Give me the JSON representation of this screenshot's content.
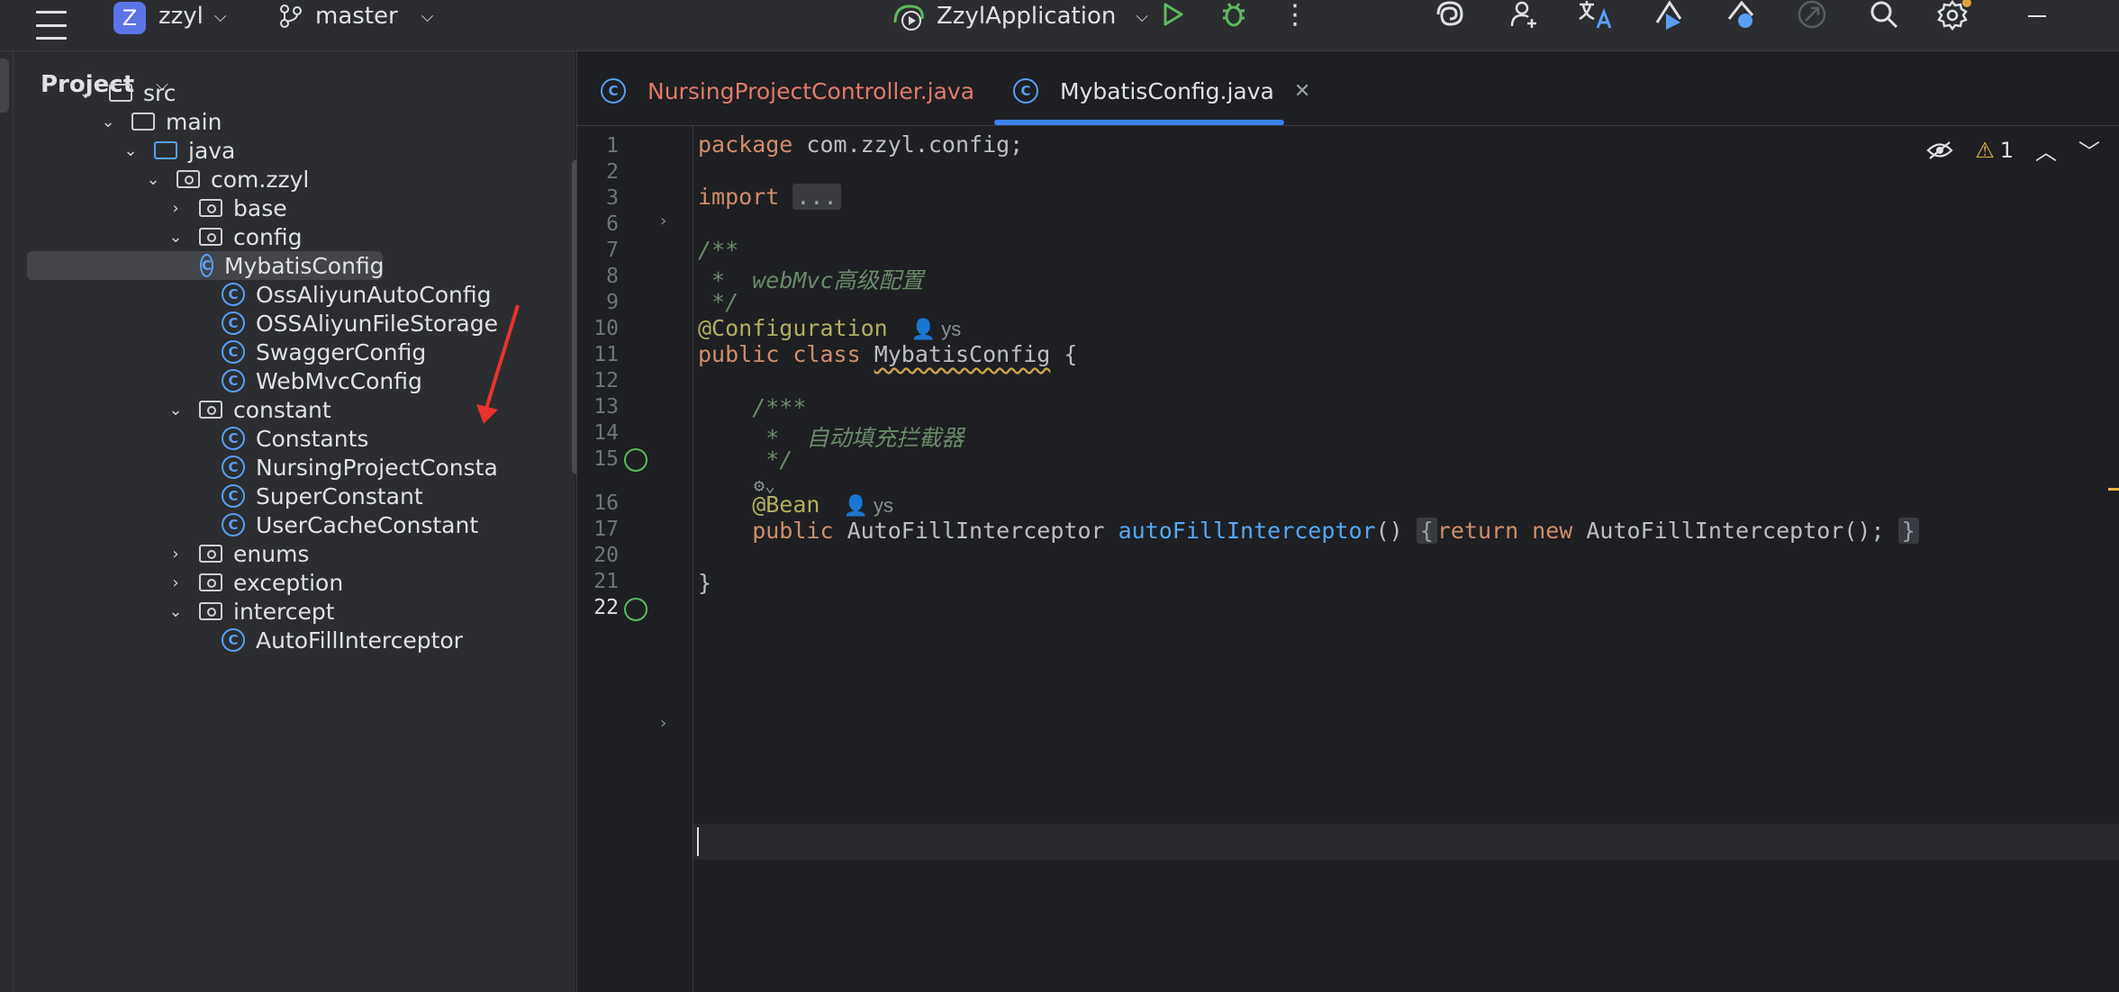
{
  "toolbar": {
    "project_initial": "Z",
    "project_name": "zzyl",
    "branch": "master",
    "run_config": "ZzylApplication",
    "icons": [
      "menu-icon",
      "branch-icon",
      "run-config-icon",
      "run-icon",
      "debug-icon",
      "more-icon",
      "ai-assistant-icon",
      "add-user-icon",
      "translate-icon",
      "deploy-icon",
      "bug-deploy-icon",
      "rocket-icon",
      "search-icon",
      "settings-icon",
      "minimize-icon"
    ]
  },
  "project_panel": {
    "title": "Project",
    "tree": [
      {
        "label": "src",
        "kind": "folder",
        "level": 0,
        "state": "open"
      },
      {
        "label": "main",
        "kind": "folder",
        "level": 1,
        "state": "open"
      },
      {
        "label": "java",
        "kind": "java",
        "level": 2,
        "state": "open"
      },
      {
        "label": "com.zzyl",
        "kind": "pkg",
        "level": 3,
        "state": "open"
      },
      {
        "label": "base",
        "kind": "pkg",
        "level": 4,
        "state": "closed"
      },
      {
        "label": "config",
        "kind": "pkg",
        "level": 4,
        "state": "open"
      },
      {
        "label": "MybatisConfig",
        "kind": "class",
        "level": 5,
        "state": "leaf",
        "selected": true
      },
      {
        "label": "OssAliyunAutoConfig",
        "kind": "class",
        "level": 5,
        "state": "leaf"
      },
      {
        "label": "OSSAliyunFileStorage",
        "kind": "class",
        "level": 5,
        "state": "leaf"
      },
      {
        "label": "SwaggerConfig",
        "kind": "class",
        "level": 5,
        "state": "leaf"
      },
      {
        "label": "WebMvcConfig",
        "kind": "class",
        "level": 5,
        "state": "leaf"
      },
      {
        "label": "constant",
        "kind": "pkg",
        "level": 4,
        "state": "open"
      },
      {
        "label": "Constants",
        "kind": "class",
        "level": 5,
        "state": "leaf"
      },
      {
        "label": "NursingProjectConsta",
        "kind": "class",
        "level": 5,
        "state": "leaf"
      },
      {
        "label": "SuperConstant",
        "kind": "class",
        "level": 5,
        "state": "leaf"
      },
      {
        "label": "UserCacheConstant",
        "kind": "class",
        "level": 5,
        "state": "leaf"
      },
      {
        "label": "enums",
        "kind": "pkg",
        "level": 4,
        "state": "closed"
      },
      {
        "label": "exception",
        "kind": "pkg",
        "level": 4,
        "state": "closed"
      },
      {
        "label": "intercept",
        "kind": "pkg",
        "level": 4,
        "state": "open"
      },
      {
        "label": "AutoFillInterceptor",
        "kind": "class",
        "level": 5,
        "state": "leaf"
      }
    ]
  },
  "editor": {
    "tabs": [
      {
        "label": "NursingProjectController.java",
        "active": false
      },
      {
        "label": "MybatisConfig.java",
        "active": true
      }
    ],
    "warning_count": "1",
    "lines": [
      "1",
      "2",
      "3",
      "6",
      "7",
      "8",
      "9",
      "10",
      "11",
      "12",
      "13",
      "14",
      "15",
      "16",
      "17",
      "20",
      "21",
      "22"
    ],
    "current_line": "22",
    "code": {
      "l1_kw": "package",
      "l1_rest": " com.zzyl.config;",
      "l3_kw": "import",
      "l3_fold": "...",
      "l7": "/**",
      "l8_prefix": " *  ",
      "l8_text": "webMvc高级配置",
      "l9": " */",
      "l10_ann": "@Configuration",
      "l10_author": "ys",
      "l11_kw": "public class",
      "l11_name": "MybatisConfig",
      "l11_rest": " {",
      "l13": "    /***",
      "l14_prefix": "     *  ",
      "l14_text": "自动填充拦截器",
      "l15": "     */",
      "l16_ann": "    @Bean",
      "l16_author": "ys",
      "l17_kw": "    public",
      "l17_type": " AutoFillInterceptor ",
      "l17_fn": "autoFillInterceptor",
      "l17_paren": "()",
      "l17_open": "{",
      "l17_return": "return new",
      "l17_ret_rest": " AutoFillInterceptor();",
      "l17_close": "}",
      "l21": "}"
    }
  }
}
